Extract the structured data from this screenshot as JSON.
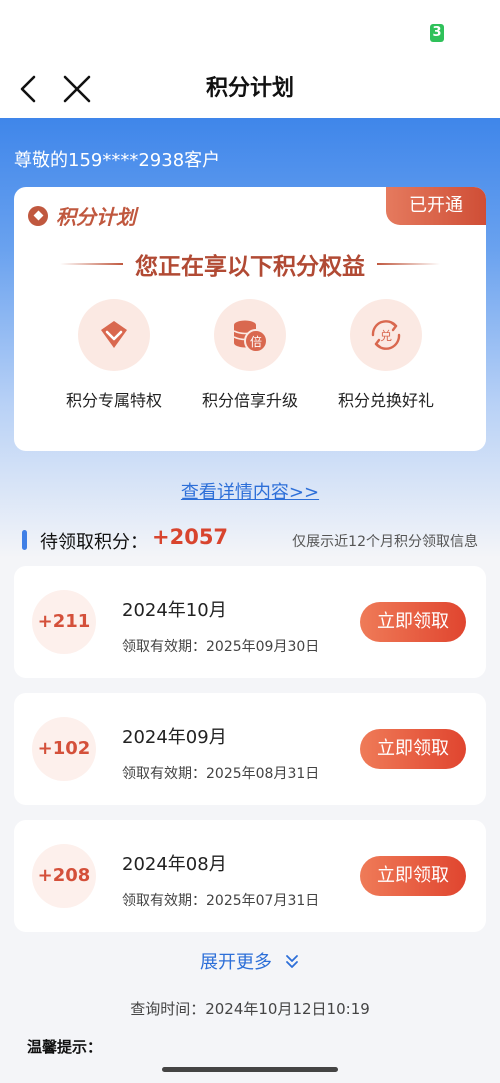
{
  "status_bar": {
    "battery": "3"
  },
  "nav": {
    "title": "积分计划"
  },
  "hero": {
    "greeting": "尊敬的159****2938客户"
  },
  "benefit_card": {
    "brand": "积分计划",
    "badge": "已开通",
    "headline": "您正在享以下积分权益",
    "benefits": [
      {
        "icon": "diamond-icon",
        "label": "积分专属特权"
      },
      {
        "icon": "coins-multiplier-icon",
        "label": "积分倍享升级",
        "icon_text": "倍"
      },
      {
        "icon": "exchange-icon",
        "label": "积分兑换好礼",
        "icon_text": "兑"
      }
    ]
  },
  "details_link": "查看详情内容>>",
  "pending": {
    "label": "待领取积分：",
    "value": "+2057",
    "note": "仅展示近12个月积分领取信息"
  },
  "items": [
    {
      "points": "+211",
      "month": "2024年10月",
      "validity": "领取有效期：2025年09月30日",
      "button": "立即领取"
    },
    {
      "points": "+102",
      "month": "2024年09月",
      "validity": "领取有效期：2025年08月31日",
      "button": "立即领取"
    },
    {
      "points": "+208",
      "month": "2024年08月",
      "validity": "领取有效期：2025年07月31日",
      "button": "立即领取"
    }
  ],
  "expand": {
    "label": "展开更多"
  },
  "query_time": "查询时间：2024年10月12日10:19",
  "tips": {
    "title": "温馨提示："
  },
  "colors": {
    "primary_blue": "#3f7fe6",
    "accent_red": "#e0452f",
    "brand_brown": "#c0583f"
  }
}
